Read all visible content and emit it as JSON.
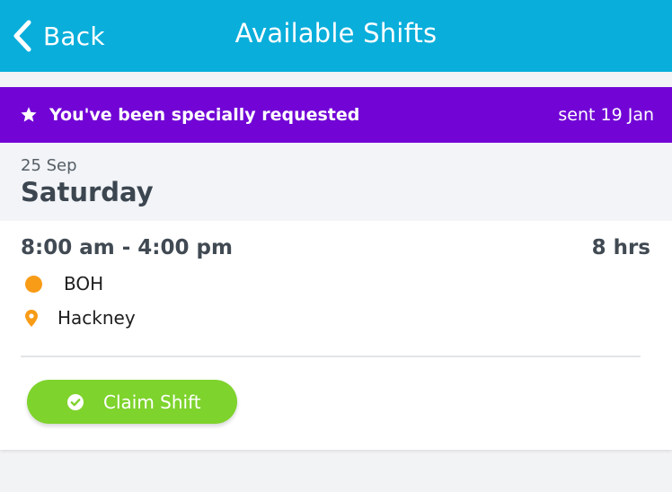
{
  "header": {
    "back_label": "Back",
    "title": "Available Shifts"
  },
  "banner": {
    "text": "You've been specially requested",
    "sent": "sent 19 Jan",
    "icon": "star-icon"
  },
  "shift": {
    "date": "25 Sep",
    "day": "Saturday",
    "time": "8:00 am - 4:00 pm",
    "hours": "8 hrs",
    "role": "BOH",
    "location": "Hackney",
    "claim_label": "Claim Shift"
  },
  "colors": {
    "header": "#09aedb",
    "banner": "#7205d6",
    "role_dot": "#f89b16",
    "claim_button": "#7ed32c"
  }
}
